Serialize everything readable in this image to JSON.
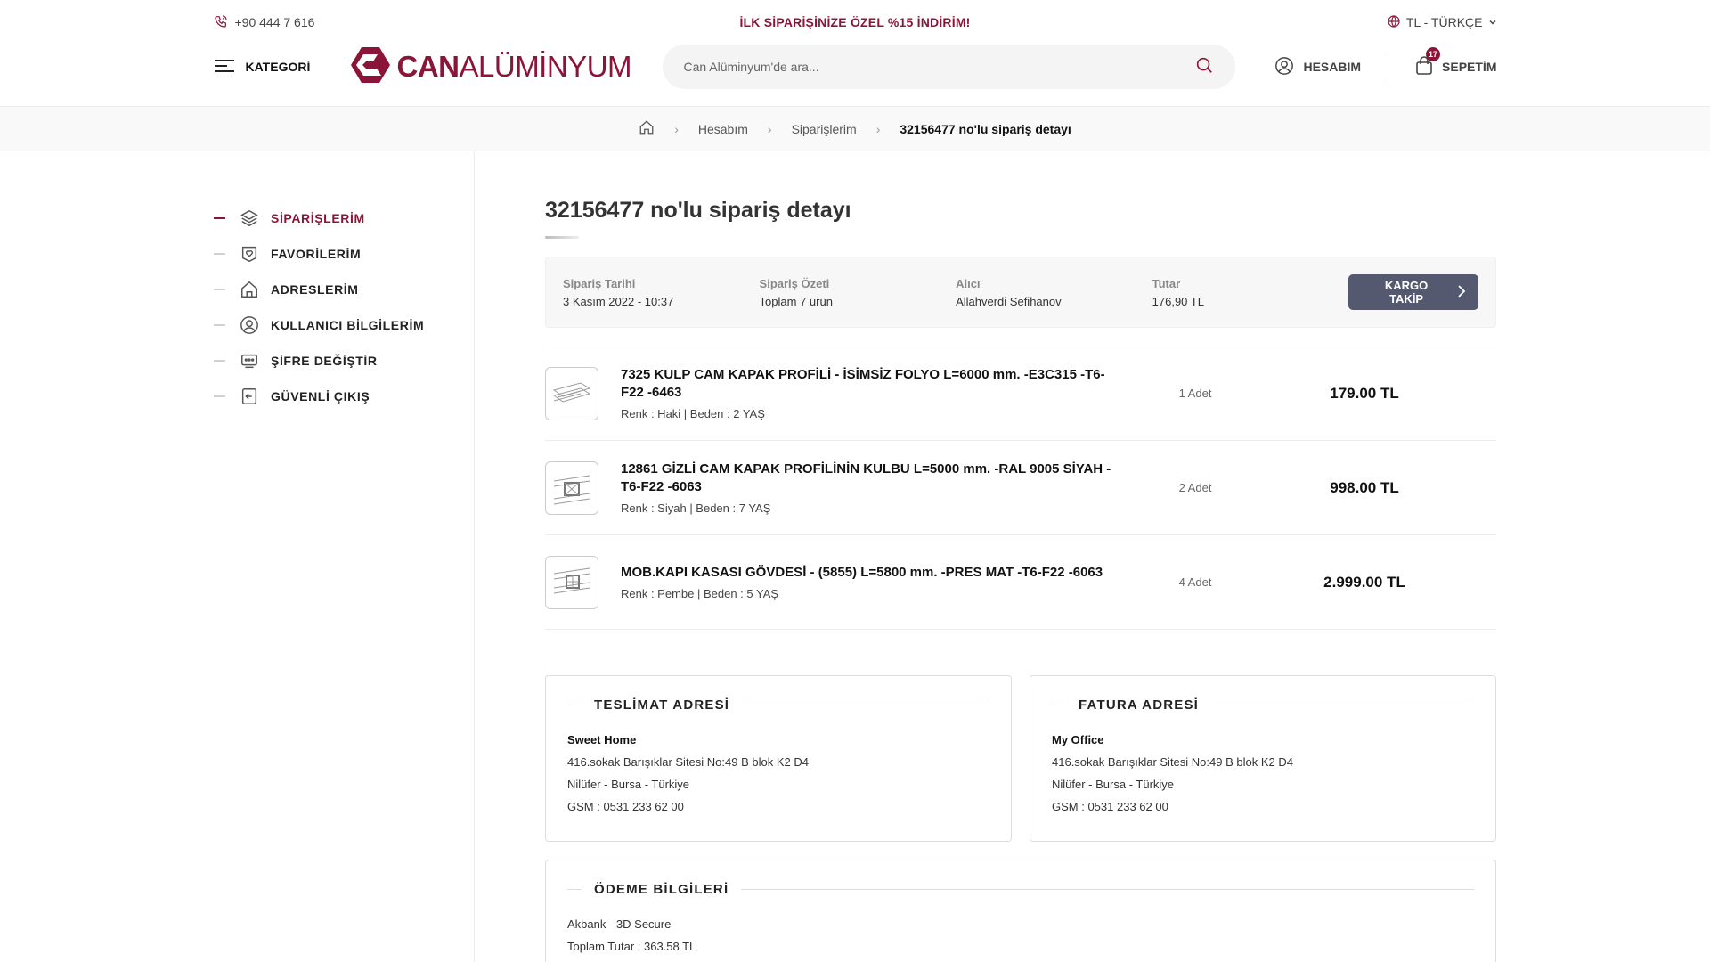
{
  "topbar": {
    "phone": "+90 444 7 616",
    "promo": "İLK SİPARİŞİNİZE ÖZEL %15 İNDİRİM!",
    "lang": "TL - TÜRKÇE"
  },
  "header": {
    "category_label": "KATEGORİ",
    "logo_bold": "CAN",
    "logo_light": "ALÜMİNYUM",
    "search_placeholder": "Can Alüminyum'de ara...",
    "account_label": "HESABIM",
    "cart_label": "SEPETİM",
    "cart_count": "17"
  },
  "breadcrumb": {
    "items": [
      "Hesabım",
      "Siparişlerim"
    ],
    "current": "32156477 no'lu sipariş detayı"
  },
  "sidebar": {
    "items": [
      {
        "label": "SİPARİŞLERİM",
        "icon": "layers-icon",
        "active": true
      },
      {
        "label": "FAVORİLERİM",
        "icon": "heart-icon",
        "active": false
      },
      {
        "label": "ADRESLERİM",
        "icon": "home-icon",
        "active": false
      },
      {
        "label": "KULLANICI BİLGİLERİM",
        "icon": "user-icon",
        "active": false
      },
      {
        "label": "ŞİFRE DEĞİŞTİR",
        "icon": "password-icon",
        "active": false
      },
      {
        "label": "GÜVENLİ ÇIKIŞ",
        "icon": "logout-icon",
        "active": false
      }
    ]
  },
  "order": {
    "title": "32156477 no'lu sipariş detayı",
    "summary": {
      "date_label": "Sipariş Tarihi",
      "date": "3 Kasım 2022 - 10:37",
      "summary_label": "Sipariş Özeti",
      "summary": "Toplam 7 ürün",
      "buyer_label": "Alıcı",
      "buyer": "Allahverdi Sefihanov",
      "total_label": "Tutar",
      "total": "176,90 TL",
      "track_button": "KARGO TAKİP"
    },
    "items": [
      {
        "name": "7325 KULP CAM KAPAK PROFİLİ - İSİMSİZ FOLYO L=6000 mm. -E3C315 -T6-F22 -6463",
        "attrs": "Renk : Haki | Beden : 2 YAŞ",
        "qty": "1 Adet",
        "price": "179.00 TL"
      },
      {
        "name": "12861 GİZLİ CAM KAPAK PROFİLİNİN KULBU L=5000 mm. -RAL 9005 SİYAH -T6-F22 -6063",
        "attrs": "Renk : Siyah | Beden : 7 YAŞ",
        "qty": "2 Adet",
        "price": "998.00 TL"
      },
      {
        "name": "MOB.KAPI KASASI GÖVDESİ - (5855) L=5800 mm. -PRES MAT -T6-F22 -6063",
        "attrs": "Renk : Pembe | Beden : 5 YAŞ",
        "qty": "4 Adet",
        "price": "2.999.00 TL"
      }
    ]
  },
  "delivery": {
    "title": "TESLİMAT ADRESİ",
    "name": "Sweet Home",
    "line1": "416.sokak Barışıklar Sitesi No:49 B blok K2 D4",
    "line2": "Nilüfer - Bursa - Türkiye",
    "phone": "GSM : 0531 233 62 00"
  },
  "invoice": {
    "title": "FATURA ADRESİ",
    "name": "My Office",
    "line1": "416.sokak Barışıklar Sitesi No:49 B blok K2 D4",
    "line2": "Nilüfer - Bursa - Türkiye",
    "phone": "GSM : 0531 233 62 00"
  },
  "payment": {
    "title": "ÖDEME BİLGİLERİ",
    "bank": "Akbank - 3D Secure",
    "total": "Toplam Tutar : 363.58 TL"
  },
  "colors": {
    "brand": "#8b1538",
    "button": "#545970"
  }
}
